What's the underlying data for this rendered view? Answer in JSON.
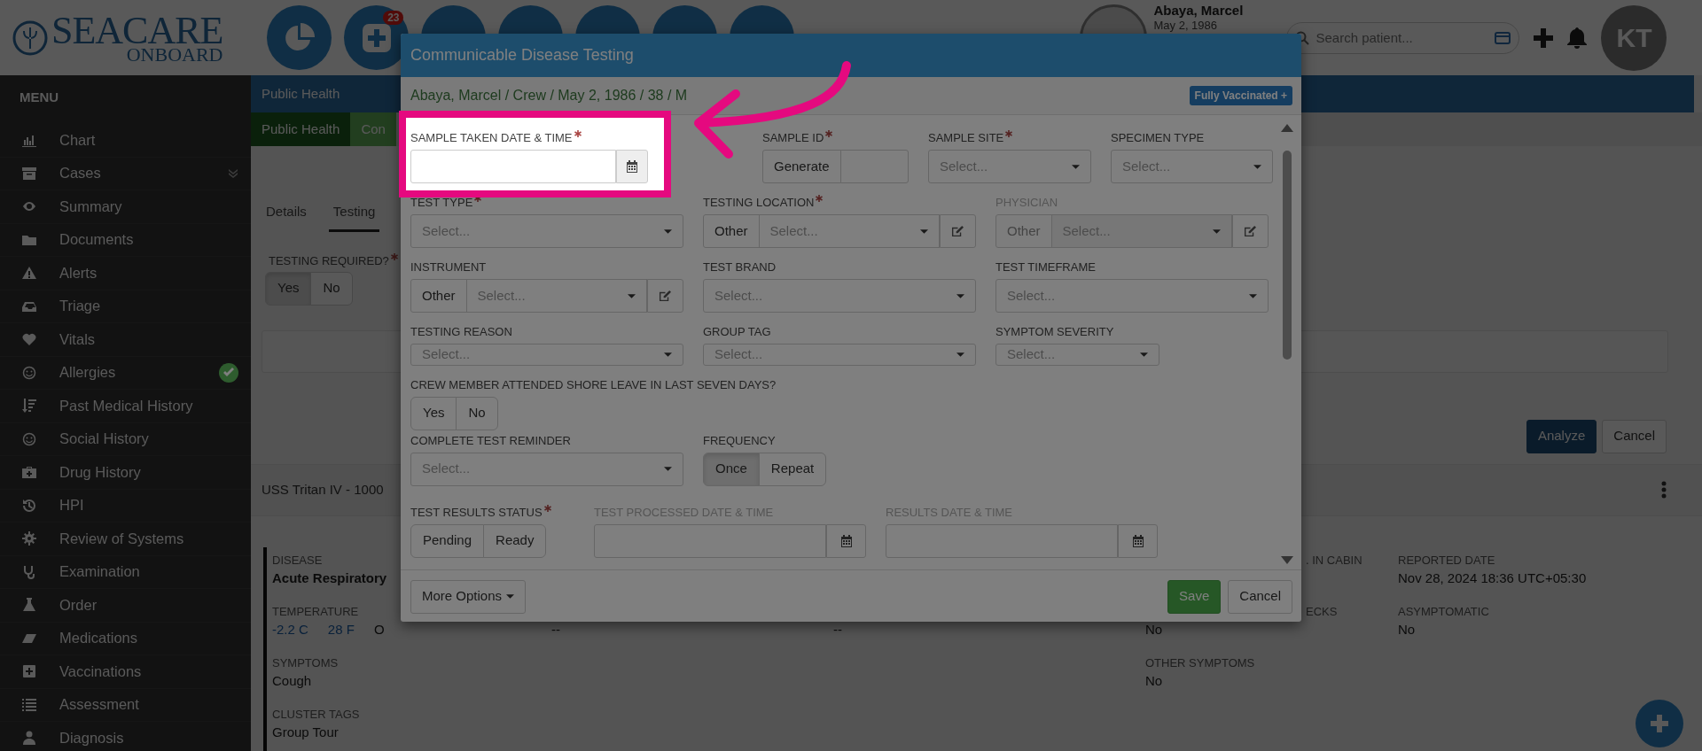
{
  "app": {
    "logo_text": "SEACARE",
    "logo_subtext": "ONBOARD"
  },
  "top_nav": {
    "badge": "23"
  },
  "patient_header": {
    "name": "Abaya, Marcel",
    "dob": "May 2, 1986"
  },
  "search": {
    "placeholder": "Search patient..."
  },
  "user": {
    "initials": "KT"
  },
  "sidebar": {
    "title": "MENU",
    "items": [
      {
        "label": "Chart",
        "expandable": false,
        "done": false
      },
      {
        "label": "Cases",
        "expandable": true,
        "done": false
      },
      {
        "label": "Summary",
        "expandable": false,
        "done": false
      },
      {
        "label": "Documents",
        "expandable": false,
        "done": false
      },
      {
        "label": "Alerts",
        "expandable": false,
        "done": false
      },
      {
        "label": "Triage",
        "expandable": false,
        "done": false
      },
      {
        "label": "Vitals",
        "expandable": false,
        "done": false
      },
      {
        "label": "Allergies",
        "expandable": false,
        "done": true
      },
      {
        "label": "Past Medical History",
        "expandable": false,
        "done": false
      },
      {
        "label": "Social History",
        "expandable": false,
        "done": false
      },
      {
        "label": "Drug History",
        "expandable": false,
        "done": false
      },
      {
        "label": "HPI",
        "expandable": false,
        "done": false
      },
      {
        "label": "Review of Systems",
        "expandable": false,
        "done": false
      },
      {
        "label": "Examination",
        "expandable": false,
        "done": false
      },
      {
        "label": "Order",
        "expandable": false,
        "done": false
      },
      {
        "label": "Medications",
        "expandable": false,
        "done": false
      },
      {
        "label": "Vaccinations",
        "expandable": false,
        "done": false
      },
      {
        "label": "Assessment",
        "expandable": false,
        "done": false
      },
      {
        "label": "Diagnosis",
        "expandable": false,
        "done": false
      }
    ]
  },
  "page": {
    "header": "Public Health",
    "tabs": [
      {
        "label": "Public Health",
        "selected": true
      },
      {
        "label": "Con",
        "selected": false
      }
    ],
    "subtabs": [
      {
        "label": "Details",
        "selected": false
      },
      {
        "label": "Testing",
        "selected": true
      }
    ],
    "testing_required": {
      "label": "TESTING REQUIRED?",
      "required": true,
      "options": [
        {
          "label": "Yes",
          "selected": true
        },
        {
          "label": "No",
          "selected": false
        }
      ]
    },
    "buttons": [
      {
        "label": "Analyze",
        "kind": "primary"
      },
      {
        "label": "Cancel",
        "kind": "default"
      }
    ],
    "record": {
      "title": "USS Tritan IV - 1000",
      "rows": [
        [
          {
            "label": "DISEASE",
            "value": "Acute Respiratory",
            "emphasis": true
          },
          {},
          {},
          {
            "label": ". IN CABIN",
            "kind": "partial"
          },
          {
            "label": "REPORTED DATE",
            "value": "Nov 28, 2024 18:36 UTC+05:30"
          }
        ],
        [
          {
            "label": "TEMPERATURE",
            "values": [
              {
                "text": "-2.2 C",
                "kind": "link"
              },
              {
                "text": "28 F",
                "kind": "link"
              },
              {
                "text": "O",
                "kind": "plain"
              }
            ]
          },
          {
            "value": "--"
          },
          {
            "value": "--"
          },
          {
            "label": "ECKS",
            "value": "No",
            "kind": "partial"
          },
          {
            "label": "ASYMPTOMATIC",
            "value": "No"
          }
        ],
        [
          {
            "label": "SYMPTOMS",
            "value": "Cough"
          },
          {},
          {},
          {
            "label": "OTHER SYMPTOMS",
            "value": "No"
          }
        ],
        [
          {
            "label": "CLUSTER TAGS",
            "value": "Group Tour"
          }
        ]
      ]
    }
  },
  "dialog": {
    "title": "Communicable Disease Testing",
    "patient_line": "Abaya, Marcel / Crew / May 2, 1986 / 38 / M",
    "badge": "Fully Vaccinated +",
    "rows": [
      [
        {
          "kind": "date",
          "label": "SAMPLE TAKEN DATE & TIME",
          "required": true,
          "disabled": false,
          "highlighted": true
        },
        {
          "kind": "generate",
          "label": "SAMPLE ID",
          "required": true,
          "button": "Generate"
        },
        {
          "kind": "select",
          "label": "SAMPLE SITE",
          "required": true,
          "placeholder": "Select..."
        },
        {
          "kind": "select",
          "label": "SPECIMEN TYPE",
          "required": false,
          "placeholder": "Select..."
        }
      ],
      [
        {
          "kind": "select",
          "label": "TEST TYPE",
          "required": true,
          "placeholder": "Select..."
        },
        {
          "kind": "other_select",
          "label": "TESTING LOCATION",
          "required": true,
          "disabled": false,
          "button": "Other",
          "placeholder": "Select..."
        },
        {
          "kind": "other_select",
          "label": "PHYSICIAN",
          "required": false,
          "disabled": true,
          "button": "Other",
          "placeholder": "Select..."
        }
      ],
      [
        {
          "kind": "other_select",
          "label": "INSTRUMENT",
          "required": false,
          "disabled": false,
          "button": "Other",
          "placeholder": "Select..."
        },
        {
          "kind": "select",
          "label": "TEST BRAND",
          "required": false,
          "placeholder": "Select..."
        },
        {
          "kind": "select",
          "label": "TEST TIMEFRAME",
          "required": false,
          "placeholder": "Select..."
        }
      ],
      [
        {
          "kind": "select",
          "label": "TESTING REASON",
          "required": false,
          "placeholder": "Select..."
        },
        {
          "kind": "select",
          "label": "GROUP TAG",
          "required": false,
          "placeholder": "Select..."
        },
        {
          "kind": "select",
          "label": "SYMPTOM SEVERITY",
          "required": false,
          "placeholder": "Select...",
          "compact": true
        }
      ],
      [
        {
          "kind": "toggle",
          "label": "CREW MEMBER ATTENDED SHORE LEAVE IN LAST SEVEN DAYS?",
          "required": false,
          "options": [
            {
              "label": "Yes",
              "selected": false
            },
            {
              "label": "No",
              "selected": false
            }
          ]
        }
      ],
      [
        {
          "kind": "select",
          "label": "COMPLETE TEST REMINDER",
          "required": false,
          "placeholder": "Select..."
        },
        {
          "kind": "toggle",
          "label": "FREQUENCY",
          "required": false,
          "options": [
            {
              "label": "Once",
              "selected": true
            },
            {
              "label": "Repeat",
              "selected": false
            }
          ]
        }
      ],
      [
        {
          "kind": "toggle",
          "label": "TEST RESULTS STATUS",
          "required": true,
          "options": [
            {
              "label": "Pending",
              "selected": false
            },
            {
              "label": "Ready",
              "selected": false
            }
          ]
        },
        {
          "kind": "date",
          "label": "TEST PROCESSED DATE & TIME",
          "required": false,
          "disabled": true
        },
        {
          "kind": "date",
          "label": "RESULTS DATE & TIME",
          "required": false,
          "disabled": true
        }
      ]
    ],
    "footer": {
      "more": "More Options",
      "save": "Save",
      "cancel": "Cancel"
    }
  }
}
